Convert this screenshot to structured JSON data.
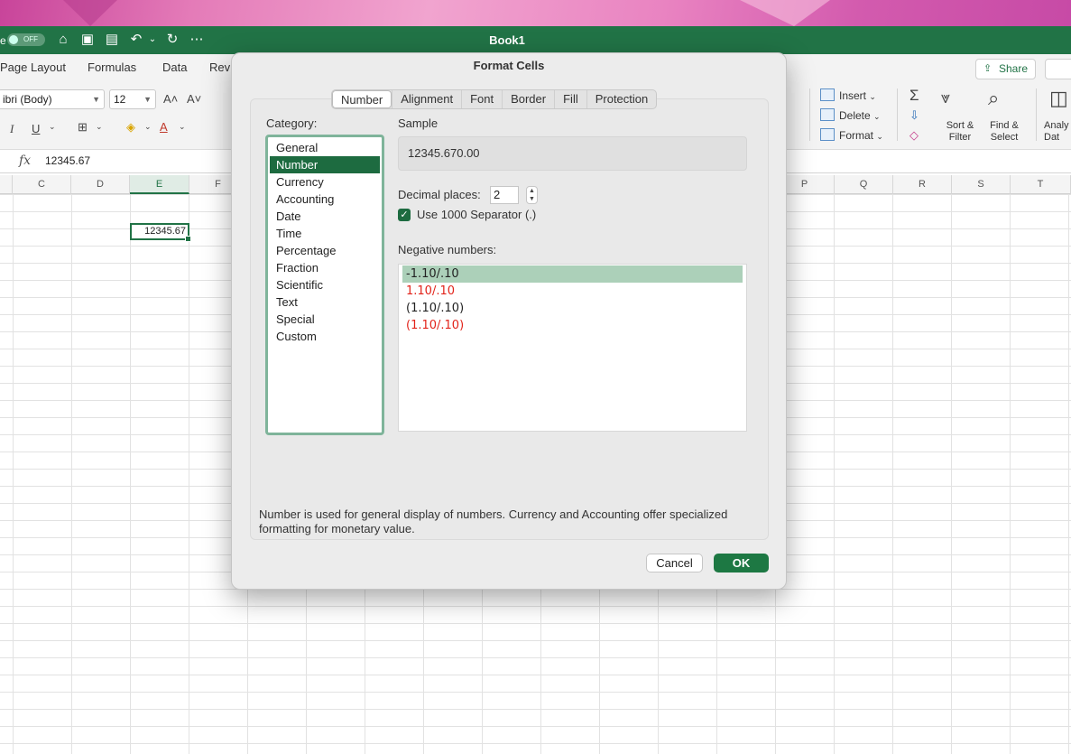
{
  "window": {
    "title": "Book1",
    "autosave_label": "e",
    "toggle_label": "OFF"
  },
  "ribbon": {
    "tabs": [
      "Page Layout",
      "Formulas",
      "Data",
      "Rev"
    ],
    "font_name": "ibri (Body)",
    "font_size": "12",
    "cells_group": {
      "insert": "Insert",
      "delete": "Delete",
      "format": "Format"
    },
    "editing_group": {
      "sort_filter": "Sort &\nFilter",
      "find_select": "Find &\nSelect",
      "analyze": "Analy\nDat"
    },
    "share": "Share"
  },
  "formula_bar": {
    "value": "12345.67"
  },
  "sheet": {
    "columns_left": [
      "C",
      "D",
      "E",
      "F"
    ],
    "columns_right": [
      "P",
      "Q",
      "R",
      "S",
      "T"
    ],
    "active_cell_value": "12345.67"
  },
  "dialog": {
    "title": "Format Cells",
    "tabs": [
      "Number",
      "Alignment",
      "Font",
      "Border",
      "Fill",
      "Protection"
    ],
    "active_tab": "Number",
    "category_label": "Category:",
    "categories": [
      "General",
      "Number",
      "Currency",
      "Accounting",
      "Date",
      "Time",
      "Percentage",
      "Fraction",
      "Scientific",
      "Text",
      "Special",
      "Custom"
    ],
    "selected_category": "Number",
    "sample_label": "Sample",
    "sample_value": "12345.670.00",
    "decimal_places_label": "Decimal places:",
    "decimal_places_value": "2",
    "separator_label": "Use 1000 Separator (.)",
    "separator_checked": true,
    "negative_label": "Negative numbers:",
    "negative_options": [
      {
        "text": "-1.10/.10",
        "color": "#222222"
      },
      {
        "text": "1.10/.10",
        "color": "#e2231a"
      },
      {
        "text": "(1.10/.10)",
        "color": "#222222"
      },
      {
        "text": "(1.10/.10)",
        "color": "#e2231a"
      }
    ],
    "description": "Number is used for general display of numbers.  Currency and Accounting offer specialized formatting for monetary value.",
    "cancel_label": "Cancel",
    "ok_label": "OK"
  },
  "colors": {
    "accent": "#217346",
    "selected": "#1d6b40"
  }
}
